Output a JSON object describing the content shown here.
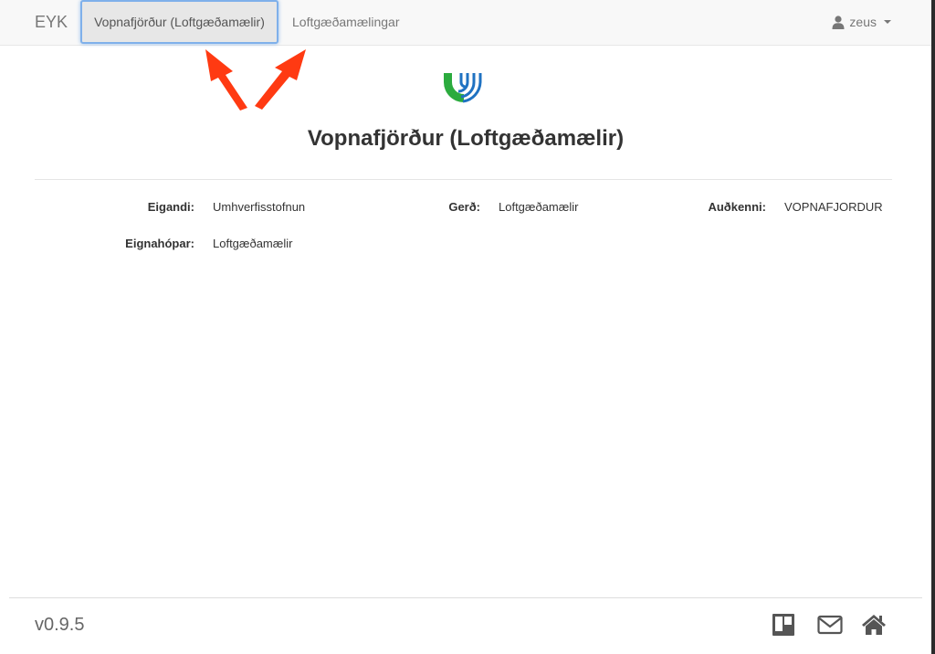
{
  "navbar": {
    "brand": "EYK",
    "active_tab": "Vopnafjörður (Loftgæðamælir)",
    "tab_measurements": "Loftgæðamælingar",
    "user": "zeus"
  },
  "page": {
    "title": "Vopnafjörður (Loftgæðamælir)"
  },
  "fields": {
    "owner_label": "Eigandi:",
    "owner_value": "Umhverfisstofnun",
    "type_label": "Gerð:",
    "type_value": "Loftgæðamælir",
    "id_label": "Auðkenni:",
    "id_value": "VOPNAFJORDUR",
    "groups_label": "Eignahópar:",
    "groups_value": "Loftgæðamælir"
  },
  "footer": {
    "version": "v0.9.5"
  },
  "icons": [
    "user-icon",
    "caret-down-icon",
    "trello-icon",
    "envelope-icon",
    "home-icon"
  ],
  "colors": {
    "logo_green": "#2bab3e",
    "logo_blue": "#1f72c2",
    "annotation_arrow": "#ff3a12",
    "active_tab_outline": "#7fb0ea"
  }
}
